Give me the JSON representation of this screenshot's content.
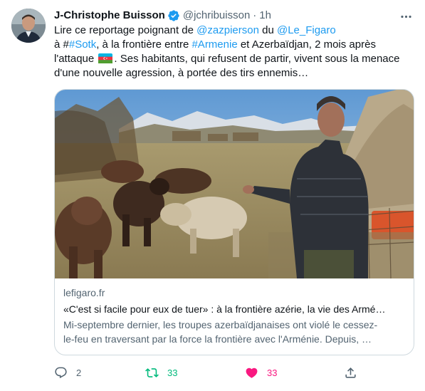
{
  "tweet": {
    "author_name": "J-Christophe Buisson",
    "handle": "@jchribuisson",
    "separator": "·",
    "time": "1h",
    "text": {
      "l1_a": "Lire ce reportage poignant de ",
      "l1_mention1": "@zazpierson",
      "l1_b": " du ",
      "l1_mention2": "@Le_Figaro",
      "l2_a": "à #",
      "l2_tag1": "#Sotk",
      "l2_b": ", à la frontière entre ",
      "l2_tag2": "#Armenie",
      "l2_c": " et Azerbaïdjan, 2 mois après",
      "l3_a": "l'attaque ",
      "l3_b": ". Ses habitants, qui refusent de partir, vivent sous la menace",
      "l4": "d'une nouvelle agression, à portée des tirs ennemis…"
    },
    "card": {
      "domain": "lefigaro.fr",
      "title": "«C'est si facile pour eux de tuer» : à la frontière azérie, la vie des Armé…",
      "desc_l1": "Mi-septembre dernier, les troupes azerbaïdjanaises ont violé le cessez-",
      "desc_l2": "le-feu en traversant par la force la frontière avec l'Arménie. Depuis, …"
    },
    "actions": {
      "reply_count": "2",
      "retweet_count": "33",
      "like_count": "33"
    },
    "colors": {
      "link": "#1d9bf0",
      "retweet": "#00ba7c",
      "like": "#f91880",
      "secondary": "#536471"
    }
  }
}
